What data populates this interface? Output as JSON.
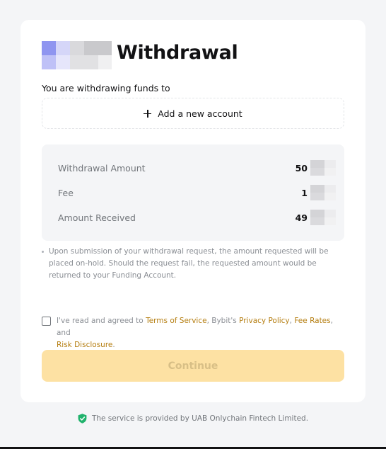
{
  "header": {
    "title": "Withdrawal",
    "logo_colors": [
      "#8f95f0",
      "#d5d6f8",
      "#d9d9dc",
      "#c9c9cc",
      "#bfc1f7",
      "#e6e6fb",
      "#e1e1e3",
      "#f0f0f1"
    ]
  },
  "destination": {
    "subtitle": "You are withdrawing funds to",
    "add_account_label": "Add a new account"
  },
  "summary": {
    "rows": [
      {
        "label": "Withdrawal Amount",
        "value": "50"
      },
      {
        "label": "Fee",
        "value": "1"
      },
      {
        "label": "Amount Received",
        "value": "49"
      }
    ]
  },
  "note": "Upon submission of your withdrawal request, the amount requested will be placed on-hold. Should the request fail, the requested amount would be returned to your Funding Account.",
  "agreement": {
    "checked": false,
    "prefix": "I've read and agreed to ",
    "terms": "Terms of Service",
    "middle": ", Bybit's ",
    "privacy": "Privacy Policy",
    "comma": ", ",
    "fees": "Fee Rates",
    "and": ", and",
    "risk": "Risk Disclosure",
    "period": "."
  },
  "continue_label": "Continue",
  "footer": {
    "text": "The service is provided by UAB Onlychain Fintech Limited."
  },
  "colors": {
    "accent": "#f7a600",
    "link": "#b57e11",
    "continue_bg": "#fde1a3",
    "shield": "#20b26c"
  }
}
